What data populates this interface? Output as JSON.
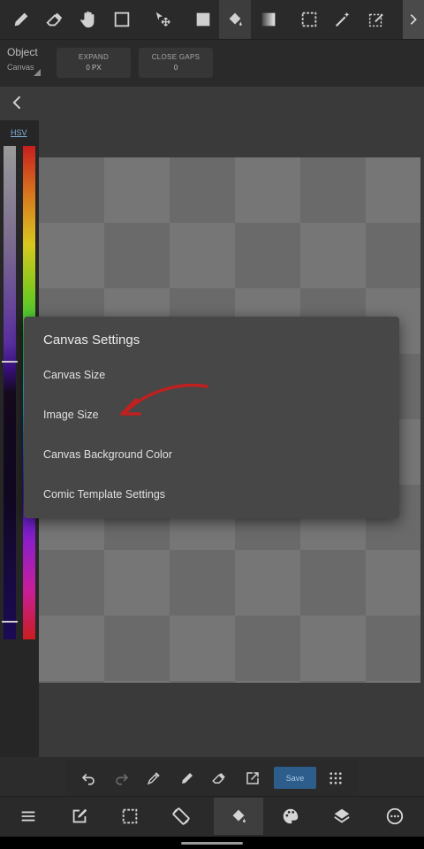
{
  "options": {
    "object_label": "Object",
    "object_value": "Canvas",
    "expand_title": "EXPAND",
    "expand_value": "0 PX",
    "close_gaps_title": "CLOSE GAPS",
    "close_gaps_value": "0"
  },
  "color_panel": {
    "mode_label": "HSV"
  },
  "dialog": {
    "title": "Canvas Settings",
    "items": [
      "Canvas Size",
      "Image Size",
      "Canvas Background Color",
      "Comic Template Settings"
    ]
  },
  "quickbar": {
    "save_label": "Save"
  },
  "icons": {
    "toolbar": [
      "pencil-icon",
      "eraser-icon",
      "hand-icon",
      "square-outline-icon",
      "move-icon",
      "fill-rect-icon",
      "bucket-icon",
      "gradient-icon",
      "select-rect-icon",
      "magic-wand-icon",
      "select-pen-icon",
      "chevron-right-icon"
    ],
    "quickbar": [
      "undo-icon",
      "redo-icon",
      "eyedropper-icon",
      "pencil-icon",
      "eraser-icon",
      "export-icon",
      "grid-dots-icon"
    ],
    "bottomnav": [
      "menu-icon",
      "edit-icon",
      "selection-icon",
      "rotate-screen-icon",
      "bucket-icon",
      "palette-icon",
      "layers-icon",
      "more-circle-icon"
    ]
  },
  "colors": {
    "accent": "#2d5d8a",
    "annotation": "#c0201f",
    "dialog_bg": "#474747"
  }
}
